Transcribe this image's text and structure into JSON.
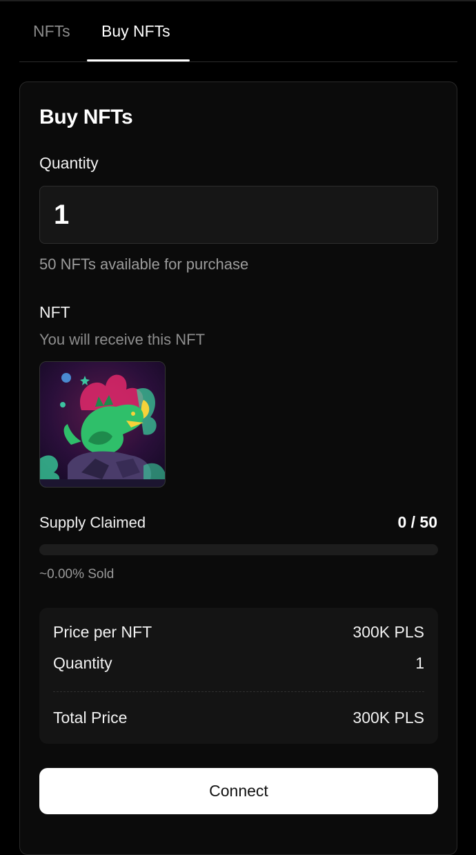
{
  "tabs": [
    {
      "label": "NFTs",
      "active": false
    },
    {
      "label": "Buy NFTs",
      "active": true
    }
  ],
  "card": {
    "title": "Buy NFTs",
    "quantity_label": "Quantity",
    "quantity_value": "1",
    "available_text": "50 NFTs available for purchase",
    "nft_label": "NFT",
    "nft_subtitle": "You will receive this NFT",
    "nft_image_icon": "green-dragon-artwork"
  },
  "supply": {
    "label": "Supply Claimed",
    "count": "0 / 50",
    "progress_fraction": 0,
    "sold_text": "~0.00% Sold"
  },
  "summary": {
    "price_label": "Price per NFT",
    "price_value": "300K PLS",
    "quantity_label": "Quantity",
    "quantity_value": "1",
    "total_label": "Total Price",
    "total_value": "300K PLS"
  },
  "connect_label": "Connect",
  "colors": {
    "background": "#000000",
    "card": "#0b0b0b",
    "panel": "#141414",
    "accent": "#ffffff"
  }
}
